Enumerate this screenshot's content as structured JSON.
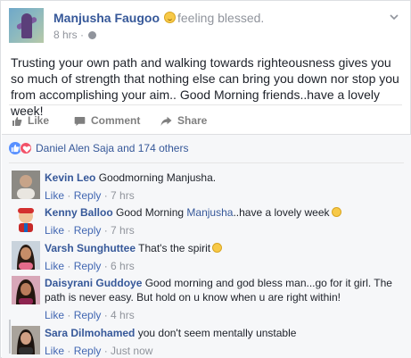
{
  "post": {
    "author": "Manjusha Faugoo",
    "feeling": "feeling blessed.",
    "time": "8 hrs",
    "separator": "·",
    "text": "Trusting your own path and walking towards righteousness gives you so much of strength that nothing else can bring you down nor stop you from accomplishing your aim.. Good Morning friends..have a lovely week!"
  },
  "actions": {
    "like": "Like",
    "comment": "Comment",
    "share": "Share"
  },
  "reactions": {
    "text": "Daniel Alen Saja and 174 others"
  },
  "comments": [
    {
      "name": "Kevin Leo",
      "text": "Goodmorning Manjusha.",
      "like": "Like",
      "reply": "Reply",
      "time": "7 hrs"
    },
    {
      "name": "Kenny Balloo",
      "text_before": "Good Morning ",
      "tag": "Manjusha",
      "text_after": "..have a lovely week",
      "like": "Like",
      "reply": "Reply",
      "time": "7 hrs"
    },
    {
      "name": "Varsh Sunghuttee",
      "text": "That's the spirit",
      "like": "Like",
      "reply": "Reply",
      "time": "6 hrs"
    },
    {
      "name": "Daisyrani Guddoye",
      "text": "Good morning and god bless man...go for it girl. The path is never easy. But hold on u know when u are right within!",
      "like": "Like",
      "reply": "Reply",
      "time": "4 hrs"
    },
    {
      "name": "Sara Dilmohamed",
      "text": "you don't seem mentally unstable",
      "like": "Like",
      "reply": "Reply",
      "time": "Just now"
    }
  ],
  "meta_sep": " · ",
  "icons": [
    "globe-icon",
    "chevron-down-icon",
    "like-icon",
    "comment-icon",
    "share-icon",
    "like-reaction-icon",
    "love-reaction-icon"
  ],
  "colors": {
    "link": "#365899",
    "muted": "#90949c",
    "like_reaction": "#5890ff",
    "love_reaction": "#f25268",
    "comments_bg": "#f6f7f9"
  }
}
